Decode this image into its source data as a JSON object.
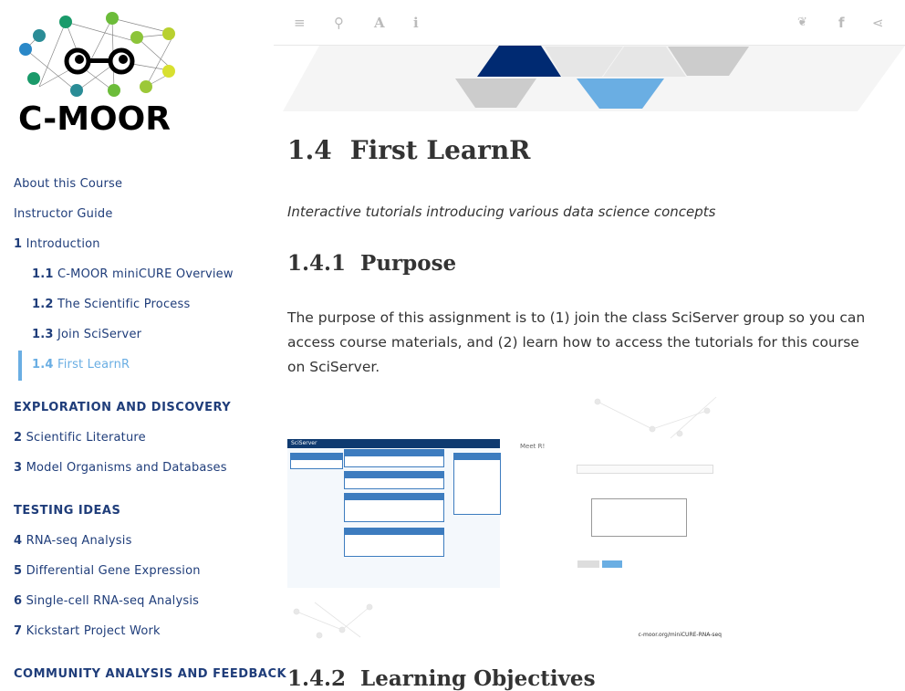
{
  "logo": {
    "text": "C-MOOR"
  },
  "toolbar": {
    "left_icons": [
      "menu-icon",
      "search-icon",
      "font-icon",
      "info-icon"
    ],
    "right_icons": [
      "twitter-icon",
      "facebook-icon",
      "share-icon"
    ]
  },
  "nav": {
    "items": [
      {
        "num": "",
        "label": "About this Course"
      },
      {
        "num": "",
        "label": "Instructor Guide"
      },
      {
        "num": "1",
        "label": "Introduction"
      },
      {
        "num": "1.1",
        "label": "C-MOOR miniCURE Overview"
      },
      {
        "num": "1.2",
        "label": "The Scientific Process"
      },
      {
        "num": "1.3",
        "label": "Join SciServer"
      },
      {
        "num": "1.4",
        "label": "First LearnR"
      },
      {
        "num": "2",
        "label": "Scientific Literature"
      },
      {
        "num": "3",
        "label": "Model Organisms and Databases"
      },
      {
        "num": "4",
        "label": "RNA-seq Analysis"
      },
      {
        "num": "5",
        "label": "Differential Gene Expression"
      },
      {
        "num": "6",
        "label": "Single-cell RNA-seq Analysis"
      },
      {
        "num": "7",
        "label": "Kickstart Project Work"
      }
    ],
    "headers": [
      "EXPLORATION AND DISCOVERY",
      "TESTING IDEAS",
      "COMMUNITY ANALYSIS AND FEEDBACK"
    ]
  },
  "main": {
    "title_num": "1.4",
    "title": "First LearnR",
    "subtitle": "Interactive tutorials introducing various data science concepts",
    "section_num": "1.4.1",
    "section": "Purpose",
    "paragraph": "The purpose of this assignment is to (1) join the class SciServer group so you can access course materials, and (2) learn how to access the tutorials for this course on SciServer.",
    "figure": {
      "left_app": "SciServer",
      "right_title": "Meet R!",
      "caption": "c-moor.org/miniCURE-RNA-seq"
    },
    "next_section_num": "1.4.2",
    "next_section": "Learning Objectives"
  },
  "colors": {
    "nav": "#1f3d7a",
    "active": "#6aaee3",
    "navy": "#002a72",
    "sky": "#6aaee3"
  }
}
